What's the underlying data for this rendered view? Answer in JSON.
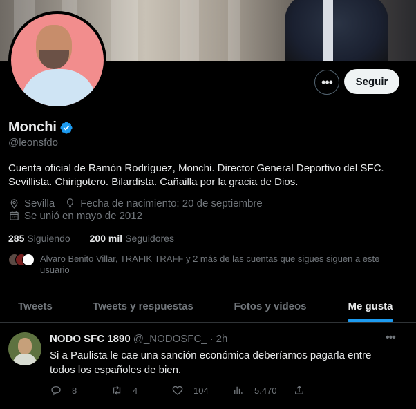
{
  "profile": {
    "name": "Monchi",
    "handle": "@leonsfdo",
    "bio": "Cuenta oficial de Ramón Rodríguez, Monchi. Director General Deportivo del SFC. Sevillista. Chirigotero. Bilardista. Cañailla por la gracia de Dios.",
    "location": "Sevilla",
    "birthday": "Fecha de nacimiento: 20 de septiembre",
    "joined": "Se unió en mayo de 2012",
    "following_count": "285",
    "following_label": "Siguiendo",
    "followers_count": "200 mil",
    "followers_label": "Seguidores",
    "mutual_text": "Alvaro Benito Villar, TRAFIK TRAFF y 2 más de las cuentas que sigues siguen a este usuario",
    "verified_color": "#1d9bf0"
  },
  "actions": {
    "more_label": "•••",
    "follow_label": "Seguir"
  },
  "tabs": [
    {
      "label": "Tweets"
    },
    {
      "label": "Tweets y respuestas"
    },
    {
      "label": "Fotos y videos"
    },
    {
      "label": "Me gusta"
    }
  ],
  "active_tab": "Me gusta",
  "tweet": {
    "author": "NODO SFC 1890",
    "handle": "@_NODOSFC_",
    "separator": "·",
    "time": "2h",
    "more_label": "•••",
    "text": "Si a Paulista le cae una sanción económica deberíamos pagarla entre todos los españoles de bien.",
    "replies": "8",
    "retweets": "4",
    "likes": "104",
    "views": "5.470"
  },
  "colors": {
    "accent": "#1d9bf0",
    "muted": "#71767b",
    "background": "#000000"
  }
}
